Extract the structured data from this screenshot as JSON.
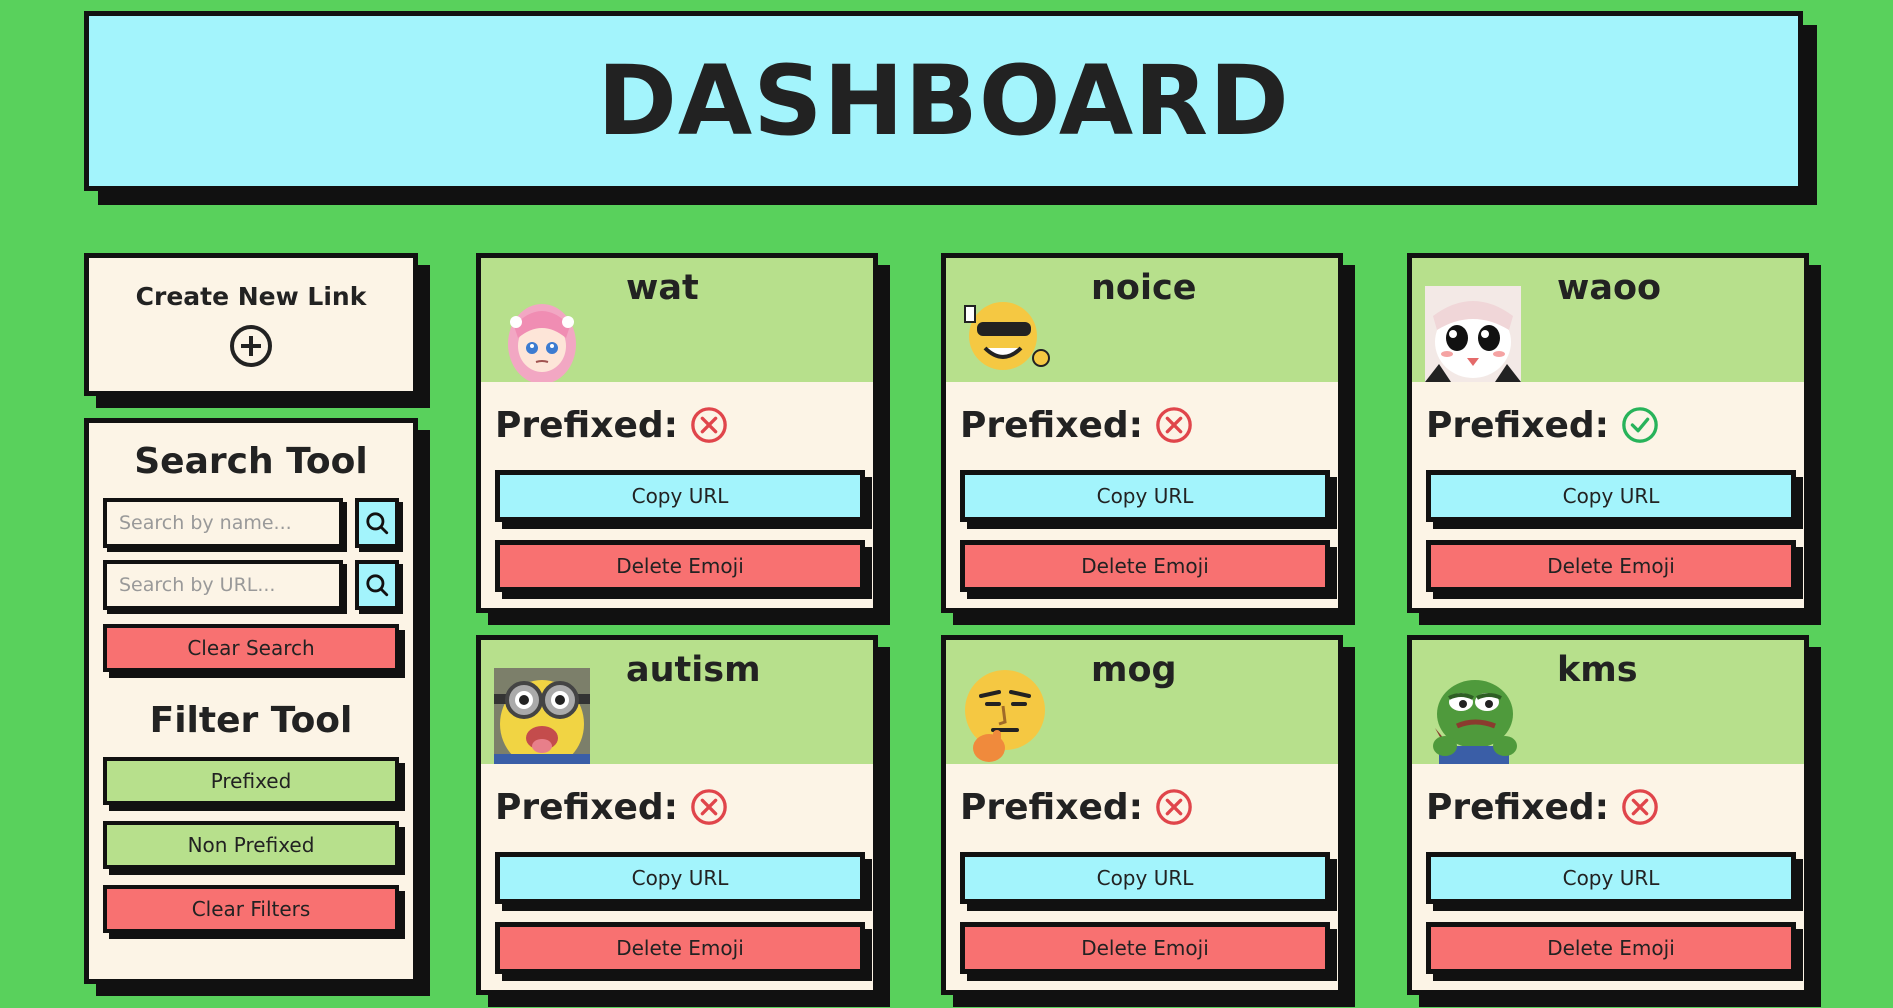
{
  "header": {
    "title": "DASHBOARD"
  },
  "sidebar": {
    "create_label": "Create New Link",
    "search_title": "Search Tool",
    "search_name_placeholder": "Search by name...",
    "search_url_placeholder": "Search by URL...",
    "clear_search_label": "Clear Search",
    "filter_title": "Filter Tool",
    "filter_prefixed_label": "Prefixed",
    "filter_non_prefixed_label": "Non Prefixed",
    "clear_filters_label": "Clear Filters"
  },
  "cards": [
    {
      "name": "wat",
      "prefixed_label": "Prefixed:",
      "prefixed": false,
      "image": "pink-haired-anime-girl",
      "copy_label": "Copy URL",
      "delete_label": "Delete Emoji"
    },
    {
      "name": "noice",
      "prefixed_label": "Prefixed:",
      "prefixed": false,
      "image": "sunglasses-smiley-thumbs-up",
      "copy_label": "Copy URL",
      "delete_label": "Delete Emoji"
    },
    {
      "name": "waoo",
      "prefixed_label": "Prefixed:",
      "prefixed": true,
      "image": "surprised-anime-face",
      "copy_label": "Copy URL",
      "delete_label": "Delete Emoji"
    },
    {
      "name": "autism",
      "prefixed_label": "Prefixed:",
      "prefixed": false,
      "image": "minion-face",
      "copy_label": "Copy URL",
      "delete_label": "Delete Emoji"
    },
    {
      "name": "mog",
      "prefixed_label": "Prefixed:",
      "prefixed": false,
      "image": "thinking-face",
      "copy_label": "Copy URL",
      "delete_label": "Delete Emoji"
    },
    {
      "name": "kms",
      "prefixed_label": "Prefixed:",
      "prefixed": false,
      "image": "sad-frog",
      "copy_label": "Copy URL",
      "delete_label": "Delete Emoji"
    }
  ],
  "colors": {
    "background": "#59d15c",
    "header": "#a3f4fc",
    "panel": "#fcf4e6",
    "card_top": "#b7e08c",
    "button_blue": "#a3f4fc",
    "button_red": "#f87171",
    "button_green": "#b7e08c",
    "status_no": "#e0454b",
    "status_yes": "#27b35a"
  }
}
